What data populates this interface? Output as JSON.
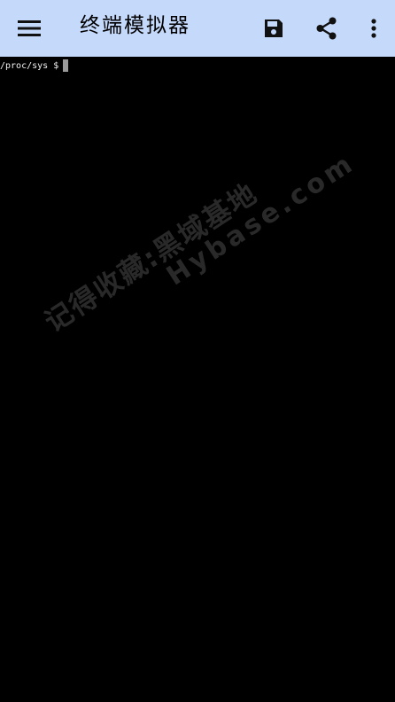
{
  "toolbar": {
    "title": "终端模拟器",
    "background": "#c5d9fb",
    "icons": {
      "menu": "hamburger-menu-icon",
      "save": "save-floppy-icon",
      "share": "share-icon",
      "more": "more-vert-icon"
    }
  },
  "terminal": {
    "prompt": "/proc/sys $",
    "background": "#000000",
    "text_color": "#f2f2f2"
  },
  "watermark": {
    "line1": "记得收藏:黑域基地",
    "line2": "Hybase.com"
  }
}
